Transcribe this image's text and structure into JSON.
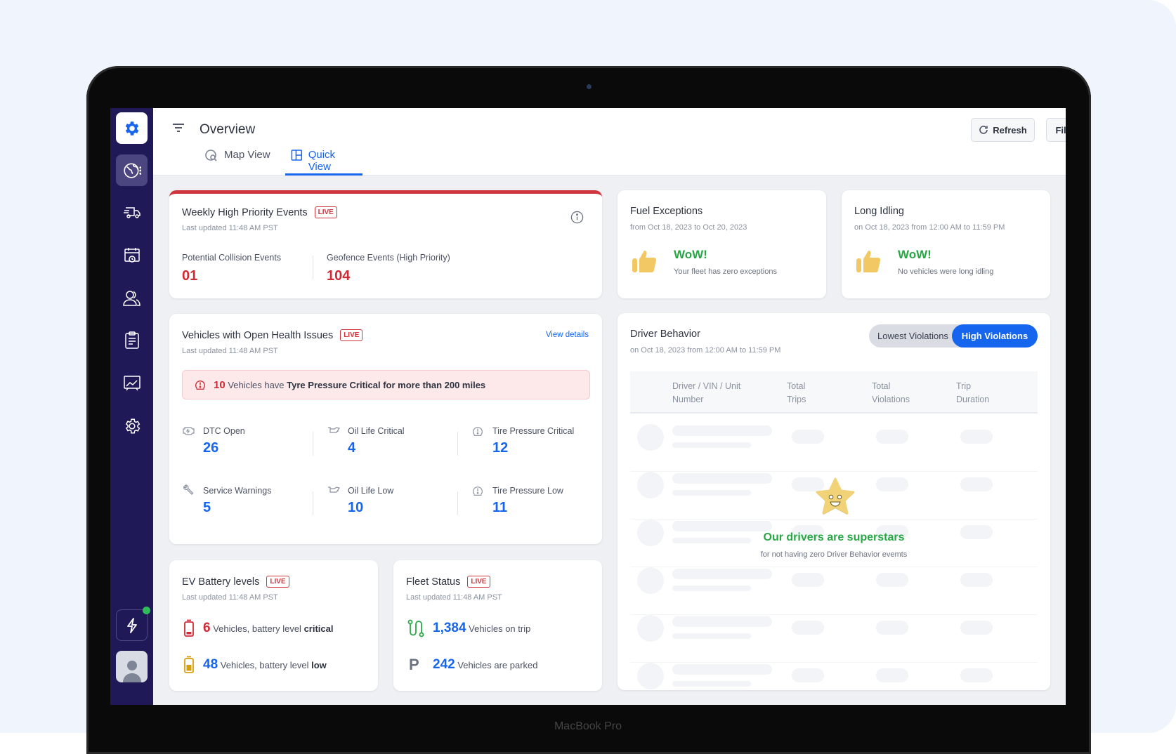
{
  "device_label": "MacBook Pro",
  "header": {
    "title": "Overview",
    "tabs": [
      {
        "label": "Map View",
        "icon": "map-search-icon",
        "active": false
      },
      {
        "label": "Quick View",
        "icon": "grid-layout-icon",
        "active": true
      }
    ],
    "refresh_label": "Refresh",
    "filters_label": "Filters"
  },
  "sidebar": {
    "items": [
      "settings-logo",
      "globe-icon",
      "truck-icon",
      "calendar-clock-icon",
      "users-icon",
      "clipboard-icon",
      "chart-board-icon",
      "gear-icon"
    ],
    "bottom": [
      "bolt-icon",
      "avatar"
    ]
  },
  "live_label": "LIVE",
  "weekly": {
    "title": "Weekly High Priority Events",
    "updated": "Last updated 11:48 AM PST",
    "metrics": [
      {
        "label": "Potential Collision Events",
        "value": "01"
      },
      {
        "label": "Geofence Events (High Priority)",
        "value": "104"
      }
    ]
  },
  "fuel": {
    "title": "Fuel Exceptions",
    "sub": "from Oct 18, 2023 to Oct 20, 2023",
    "wow": "WoW!",
    "msg": "Your fleet has zero exceptions"
  },
  "idling": {
    "title": "Long Idling",
    "sub": "on Oct 18, 2023 from 12:00 AM to 11:59 PM",
    "wow": "WoW!",
    "msg": "No vehicles were long idling"
  },
  "health": {
    "title": "Vehicles with Open Health Issues",
    "updated": "Last updated 11:48 AM PST",
    "view_details": "View details",
    "alert": {
      "count": "10",
      "text1": "Vehicles have",
      "text2": "Tyre Pressure Critical for more than 200 miles"
    },
    "metrics": [
      {
        "label": "DTC Open",
        "value": "26",
        "icon": "engine-icon"
      },
      {
        "label": "Oil Life Critical",
        "value": "4",
        "icon": "oil-can-icon"
      },
      {
        "label": "Tire Pressure Critical",
        "value": "12",
        "icon": "tire-pressure-icon"
      },
      {
        "label": "Service Warnings",
        "value": "5",
        "icon": "wrench-icon"
      },
      {
        "label": "Oil Life Low",
        "value": "10",
        "icon": "oil-can-icon"
      },
      {
        "label": "Tire Pressure Low",
        "value": "11",
        "icon": "tire-pressure-icon"
      }
    ]
  },
  "driver": {
    "title": "Driver Behavior",
    "sub": "on Oct 18, 2023 from 12:00 AM to 11:59 PM",
    "toggle": [
      "Lowest Violations",
      "High Violations"
    ],
    "columns": [
      "Driver / VIN / Unit Number",
      "Total Trips",
      "Total Violations",
      "Trip Duration"
    ],
    "empty_title": "Our drivers are superstars",
    "empty_sub": "for not having zero Driver Behavior evemts"
  },
  "ev": {
    "title": "EV Battery levels",
    "updated": "Last updated 11:48 AM PST",
    "rows": [
      {
        "value": "6",
        "text": "Vehicles, battery level",
        "strong": "critical"
      },
      {
        "value": "48",
        "text": "Vehicles, battery level",
        "strong": "low"
      }
    ]
  },
  "fleet": {
    "title": "Fleet Status",
    "updated": "Last updated 11:48 AM PST",
    "rows": [
      {
        "value": "1,384",
        "text": "Vehicles on trip"
      },
      {
        "value": "242",
        "text": "Vehicles are parked"
      }
    ],
    "parked_glyph": "P"
  }
}
